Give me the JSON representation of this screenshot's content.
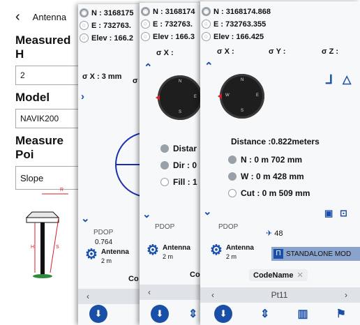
{
  "card1": {
    "title": "Antenna",
    "measured_label": "Measured H",
    "measured_value": "2",
    "model_label": "Model",
    "model_value": "NAVIK200",
    "measure_point_label": "Measure Poi",
    "measure_point_value": "Slope",
    "diagram_labels": {
      "r": "R",
      "h": "H",
      "s": "S"
    }
  },
  "card2": {
    "n": "N : 3168175",
    "e": "E : 732763.",
    "elev": "Elev : 166.2",
    "sigma_x": "σ X :  3 mm",
    "sigma_y": "σ Y",
    "pdop_label": "PDOP",
    "pdop_value": "0.764",
    "antenna_label": "Antenna",
    "antenna_value": "2 m",
    "code_partial": "Co"
  },
  "card3": {
    "n": "N : 3168174",
    "e": "E : 732763.",
    "elev": "Elev : 166.3",
    "sigma_x": "σ X :",
    "dist": "Distar",
    "dir": "Dir : 0",
    "fill": "Fill : 1",
    "pdop_label": "PDOP",
    "antenna_label": "Antenna",
    "antenna_value": "2 m",
    "code_partial": "Co"
  },
  "card4": {
    "n": "N : 3168174.868",
    "e": "E : 732763.355",
    "elev": "Elev : 166.425",
    "sigma_x": "σ X :",
    "sigma_y": "σ Y :",
    "sigma_z": "σ Z :",
    "distance": "Distance :0.822meters",
    "n_offset": "N : 0 m 702 mm",
    "w_offset": "W : 0 m 428 mm",
    "cut": "Cut : 0 m 509 mm",
    "pdop_label": "PDOP",
    "satellites": "48",
    "antenna_label": "Antenna",
    "antenna_value": "2 m",
    "mode_badge": "STANDALONE MOD",
    "code_name": "CodeName",
    "point_name": "Pt11"
  },
  "compass_letters": {
    "n": "N",
    "e": "E",
    "s": "S",
    "w": "W"
  },
  "colors": {
    "accent": "#1a4fa8",
    "north": "#d6202a",
    "compass_bg": "#1e1e1e"
  }
}
